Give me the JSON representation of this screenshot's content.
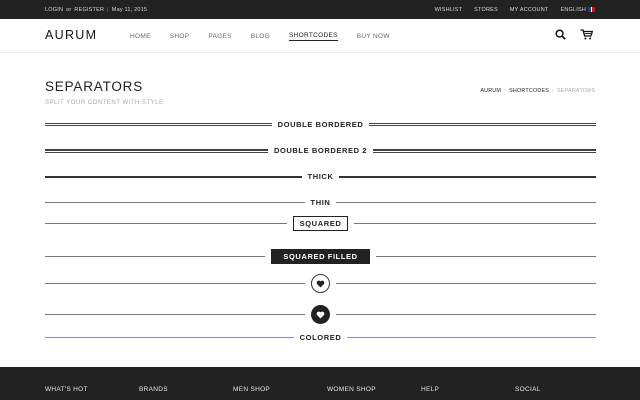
{
  "topbar": {
    "login": "LOGIN",
    "or": "or",
    "register": "REGISTER",
    "divider": "|",
    "date": "May 11, 2015",
    "links": [
      "WISHLIST",
      "STORES",
      "MY ACCOUNT",
      "ENGLISH"
    ]
  },
  "header": {
    "logo": "AURUM",
    "nav": [
      "HOME",
      "SHOP",
      "PAGES",
      "BLOG",
      "SHORTCODES",
      "BUY NOW"
    ],
    "active_nav": "SHORTCODES",
    "icons": [
      "search-icon",
      "cart-icon"
    ]
  },
  "page": {
    "title": "SEPARATORS",
    "subtitle": "SPLIT YOUR CONTENT WITH STYLE",
    "breadcrumb": [
      "AURUM",
      "SHORTCODES",
      "SEPARATORS"
    ]
  },
  "separators": {
    "double_bordered": "DOUBLE BORDERED",
    "double_bordered_2": "DOUBLE BORDERED 2",
    "thick": "THICK",
    "thin": "THIN",
    "squared": "SQUARED",
    "squared_filled": "SQUARED FILLED",
    "colored": "COLORED",
    "heart_icons": [
      "heart-icon",
      "heart-icon"
    ],
    "colored_line_color": "#8f86c8"
  },
  "footer": {
    "columns": [
      "WHAT'S HOT",
      "BRANDS",
      "MEN SHOP",
      "WOMEN SHOP",
      "HELP",
      "SOCIAL"
    ]
  }
}
